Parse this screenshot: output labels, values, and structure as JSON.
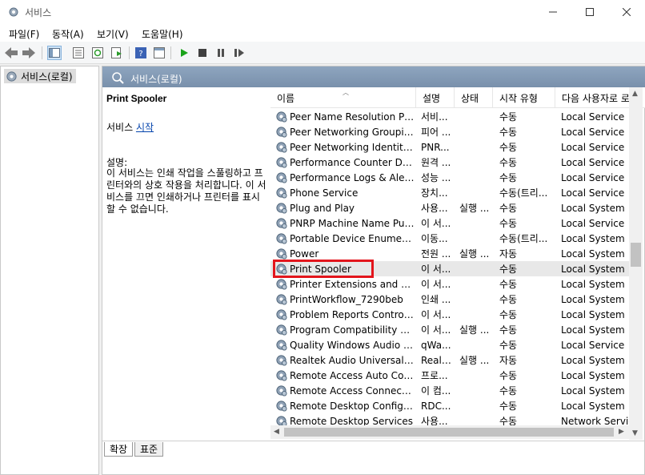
{
  "window": {
    "title": "서비스"
  },
  "menu": [
    "파일(F)",
    "동작(A)",
    "보기(V)",
    "도움말(H)"
  ],
  "toolbar": {
    "buttons": [
      "back-icon",
      "forward-icon",
      "show-hide-tree-icon",
      "properties-icon",
      "refresh-icon",
      "export-list-icon",
      "help-icon",
      "console-icon",
      "start-service-icon",
      "stop-service-icon",
      "pause-service-icon",
      "restart-service-icon"
    ],
    "colors": {
      "play": "#1aa31a",
      "stop": "#404040"
    }
  },
  "tree": {
    "root": "서비스(로컬)"
  },
  "panel": {
    "title": "서비스(로컬)"
  },
  "description": {
    "service_name": "Print Spooler",
    "action_prefix": "서비스 ",
    "action_link": "시작",
    "label": "설명:",
    "text": "이 서비스는 인쇄 작업을 스풀링하고 프린터와의 상호 작용을 처리합니다. 이 서비스를 끄면 인쇄하거나 프린터를 표시할 수 없습니다."
  },
  "columns": [
    "이름",
    "설명",
    "상태",
    "시작 유형",
    "다음 사용자로 로"
  ],
  "rows": [
    {
      "name": "Peer Name Resolution Prot...",
      "desc": "서비...",
      "status": "",
      "startup": "수동",
      "logon": "Local Service"
    },
    {
      "name": "Peer Networking Grouping",
      "desc": "피어 ...",
      "status": "",
      "startup": "수동",
      "logon": "Local Service"
    },
    {
      "name": "Peer Networking Identity ...",
      "desc": "PNR...",
      "status": "",
      "startup": "수동",
      "logon": "Local Service"
    },
    {
      "name": "Performance Counter DLL ...",
      "desc": "원격 ...",
      "status": "",
      "startup": "수동",
      "logon": "Local Service"
    },
    {
      "name": "Performance Logs & Alerts",
      "desc": "성능 ...",
      "status": "",
      "startup": "수동",
      "logon": "Local Service"
    },
    {
      "name": "Phone Service",
      "desc": "장치...",
      "status": "",
      "startup": "수동(트리...",
      "logon": "Local Service"
    },
    {
      "name": "Plug and Play",
      "desc": "사용...",
      "status": "실행 ...",
      "startup": "수동",
      "logon": "Local System"
    },
    {
      "name": "PNRP Machine Name Publi...",
      "desc": "이 서...",
      "status": "",
      "startup": "수동",
      "logon": "Local Service"
    },
    {
      "name": "Portable Device Enumerato...",
      "desc": "이동...",
      "status": "",
      "startup": "수동(트리...",
      "logon": "Local System"
    },
    {
      "name": "Power",
      "desc": "전원 ...",
      "status": "실행 ...",
      "startup": "자동",
      "logon": "Local System"
    },
    {
      "name": "Print Spooler",
      "desc": "이 서...",
      "status": "",
      "startup": "수동",
      "logon": "Local System",
      "selected": true
    },
    {
      "name": "Printer Extensions and Noti...",
      "desc": "이 서...",
      "status": "",
      "startup": "수동",
      "logon": "Local System"
    },
    {
      "name": "PrintWorkflow_7290beb",
      "desc": "인쇄 ...",
      "status": "",
      "startup": "수동",
      "logon": "Local System"
    },
    {
      "name": "Problem Reports Control P...",
      "desc": "이 서...",
      "status": "",
      "startup": "수동",
      "logon": "Local System"
    },
    {
      "name": "Program Compatibility Assi...",
      "desc": "이 서...",
      "status": "실행 ...",
      "startup": "수동",
      "logon": "Local System"
    },
    {
      "name": "Quality Windows Audio Vi...",
      "desc": "qWa...",
      "status": "",
      "startup": "수동",
      "logon": "Local Service"
    },
    {
      "name": "Realtek Audio Universal Ser...",
      "desc": "Realt...",
      "status": "실행 ...",
      "startup": "자동",
      "logon": "Local System"
    },
    {
      "name": "Remote Access Auto Conn...",
      "desc": "프로...",
      "status": "",
      "startup": "수동",
      "logon": "Local System"
    },
    {
      "name": "Remote Access Connection...",
      "desc": "이 컴...",
      "status": "",
      "startup": "수동",
      "logon": "Local System"
    },
    {
      "name": "Remote Desktop Configura...",
      "desc": "RDC...",
      "status": "",
      "startup": "수동",
      "logon": "Local System"
    },
    {
      "name": "Remote Desktop Services",
      "desc": "사용...",
      "status": "",
      "startup": "수동",
      "logon": "Network Service"
    }
  ],
  "tabs": [
    "확장",
    "표준"
  ],
  "highlight_color": "#e3151c"
}
